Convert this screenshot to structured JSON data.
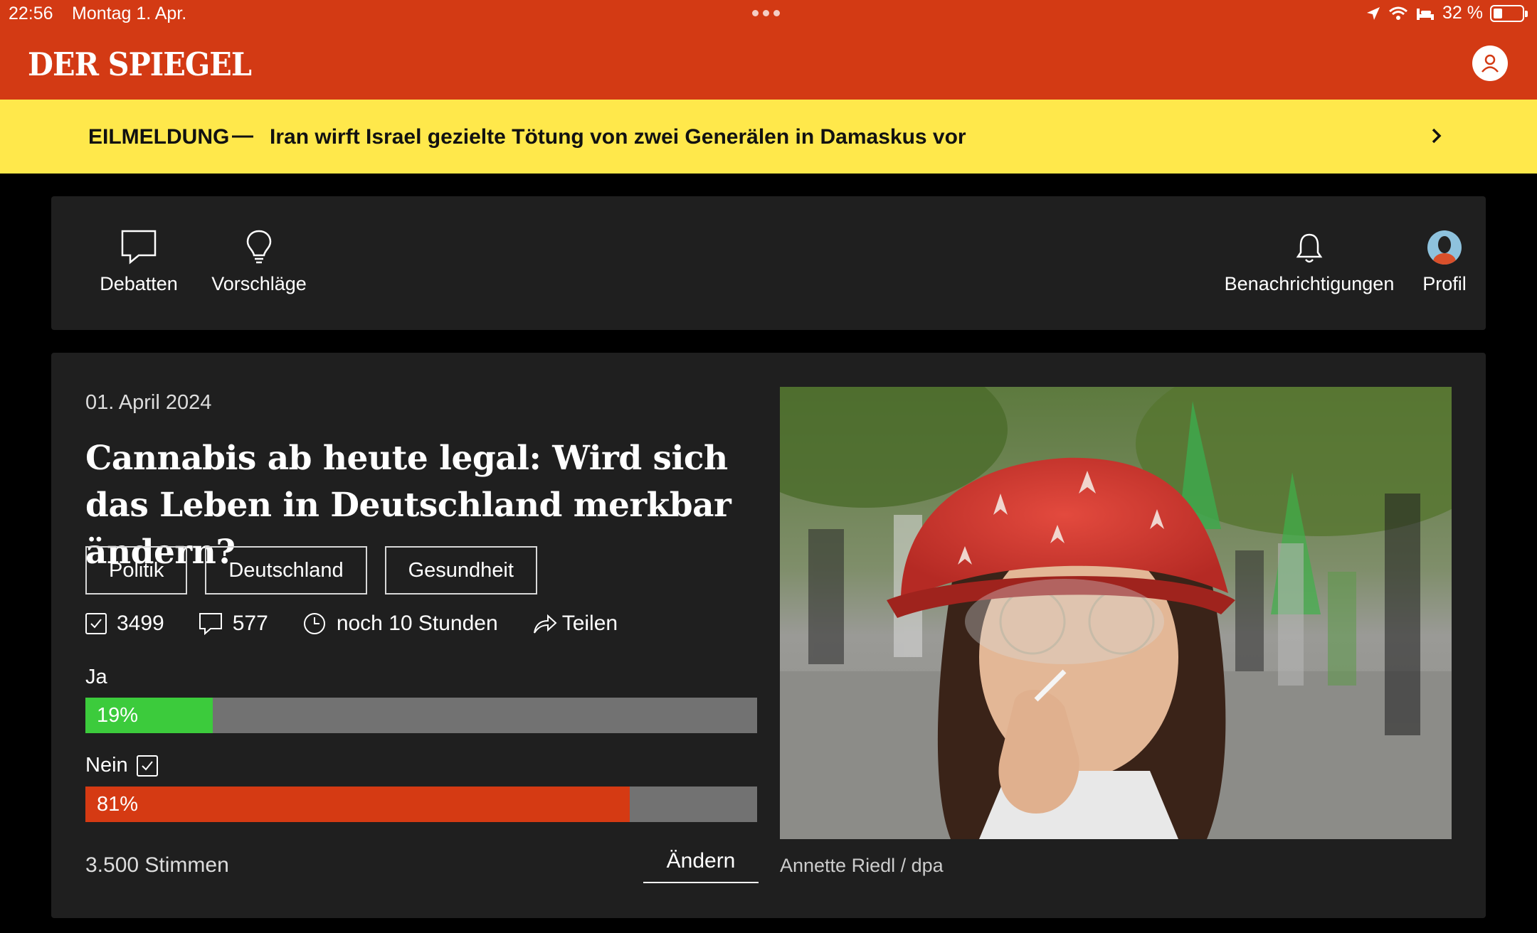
{
  "status_bar": {
    "time": "22:56",
    "date": "Montag 1. Apr.",
    "battery": "32 %"
  },
  "header": {
    "logo": "DER SPIEGEL",
    "accent_color": "#d33a14"
  },
  "breaking": {
    "label": "EILMELDUNG",
    "dash": "—",
    "headline": "Iran wirft Israel gezielte Tötung von zwei Generälen in Damaskus vor",
    "background": "#ffe84b"
  },
  "nav": {
    "debatten": "Debatten",
    "vorschlaege": "Vorschläge",
    "benachrichtigungen": "Benachrichtigungen",
    "profil": "Profil"
  },
  "poll": {
    "date": "01. April 2024",
    "title": "Cannabis ab heute legal: Wird sich das Leben in Deutschland merkbar ändern?",
    "tags": [
      "Politik",
      "Deutschland",
      "Gesundheit"
    ],
    "participants": "3499",
    "comments": "577",
    "remaining": "noch 10 Stunden",
    "share": "Teilen",
    "options": [
      {
        "label": "Ja",
        "percent_text": "19%",
        "percent": 19,
        "color": "#3ccb3c",
        "selected": false
      },
      {
        "label": "Nein",
        "percent_text": "81%",
        "percent": 81,
        "color": "#d53a13",
        "selected": true
      }
    ],
    "votes": "3.500 Stimmen",
    "change_button": "Ändern",
    "image_caption": "Annette Riedl / dpa"
  }
}
